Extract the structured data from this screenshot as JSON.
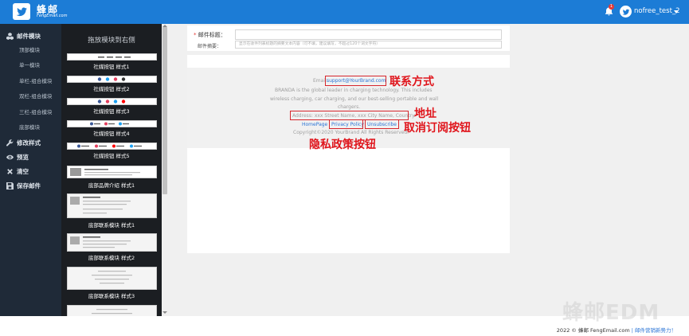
{
  "app": {
    "name": "蜂邮",
    "domain": "FengEmail.com",
    "notification_count": "1",
    "username": "nofree_test_2"
  },
  "sidebar": {
    "groups": [
      {
        "label": "邮件模块",
        "icon": "cubes-icon"
      },
      {
        "label": "修改样式",
        "icon": "wrench-icon"
      },
      {
        "label": "预览",
        "icon": "eye-icon"
      },
      {
        "label": "清空",
        "icon": "close-icon"
      },
      {
        "label": "保存邮件",
        "icon": "save-icon"
      }
    ],
    "sub_items": [
      "顶部模块",
      "单一模块",
      "单栏-组合模块",
      "双栏-组合模块",
      "三栏-组合模块",
      "底部模块"
    ]
  },
  "module_panel": {
    "title": "拖放模块到右侧",
    "modules": [
      "社媒按钮 样式1",
      "社媒按钮 样式2",
      "社媒按钮 样式3",
      "社媒按钮 样式4",
      "社媒按钮 样式5",
      "底部品牌介绍 样式1",
      "底部联系模块 样式1",
      "底部联系模块 样式2",
      "底部联系模块 样式3"
    ]
  },
  "form": {
    "subject_label": "邮件标题：",
    "subject_required": "*",
    "subject_value": "",
    "summary_label": "邮件摘要：",
    "summary_placeholder": "显示在收件列表标题的摘要文本内容（可不填，建议填写，不超过120个词文字符）"
  },
  "email_footer": {
    "email_prefix": "Email: ",
    "email": "support@YourBrand.com",
    "desc_line1": "BRANDA is the global leader in charging technology. This includes",
    "desc_line2": "wireless charging, car charging, and our best-selling portable and wall",
    "desc_line3": "chargers.",
    "address": "Address: xxx Street Name, xxx City Name, Country.",
    "homepage": "HomePage",
    "privacy": "Privacy Policy",
    "unsubscribe": "Unsubscribe",
    "copyright": "Copyright©2020 YourBrand All Rights Reserved."
  },
  "annotations": {
    "contact": "联系方式",
    "address": "地址",
    "unsubscribe": "取消订阅按钮",
    "privacy": "隐私政策按钮"
  },
  "page_footer": {
    "copyright": "2022 © 蜂邮 FengEmail.com",
    "slogan": "| 邮件营销新势力！",
    "watermark": "蜂邮EDM"
  },
  "colors": {
    "brand_blue": "#1c7cd6",
    "annotation_red": "#e0141b",
    "sidebar_bg": "#1f2a38",
    "panel_bg": "#1b1e22"
  }
}
